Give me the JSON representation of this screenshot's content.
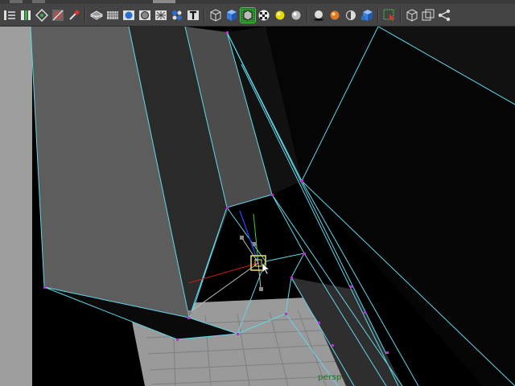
{
  "toolbar": {
    "buttons": [
      {
        "icon": "channel-box-icon"
      },
      {
        "icon": "attribute-editor-icon"
      },
      {
        "icon": "tool-settings-icon"
      },
      {
        "icon": "render-settings-icon"
      },
      {
        "icon": "paint-tool-icon"
      },
      {
        "icon": "layer-editor-icon"
      },
      {
        "icon": "grid-toggle-icon"
      },
      {
        "icon": "smooth-shade-icon"
      },
      {
        "icon": "wireframe-on-shaded-icon"
      },
      {
        "icon": "xray-icon"
      },
      {
        "icon": "texture-display-icon"
      },
      {
        "icon": "text-icon"
      },
      {
        "icon": "wireframe-cube-icon"
      },
      {
        "icon": "shaded-cube-icon"
      },
      {
        "icon": "isolate-select-icon"
      },
      {
        "icon": "texture-checker-icon"
      },
      {
        "icon": "lighting-default-icon"
      },
      {
        "icon": "lighting-all-icon"
      },
      {
        "icon": "shadows-icon"
      },
      {
        "icon": "ambient-occlusion-icon"
      },
      {
        "icon": "motion-blur-icon"
      },
      {
        "icon": "anti-aliasing-icon"
      },
      {
        "icon": "depth-of-field-icon"
      },
      {
        "icon": "select-highlight-icon"
      },
      {
        "icon": "camera-icon"
      },
      {
        "icon": "frame-icon"
      },
      {
        "icon": "share-icon"
      }
    ]
  },
  "viewport": {
    "camera_label": "persp",
    "colors": {
      "background": "#000000",
      "wireframe": "#5fd8ea",
      "vertex": "#c02ad8",
      "grid_floor": "#9a9a9a",
      "x_axis": "#d01818",
      "y_axis": "#3ad03a",
      "z_axis": "#2040d0",
      "manipulator": "#f0e060"
    }
  }
}
